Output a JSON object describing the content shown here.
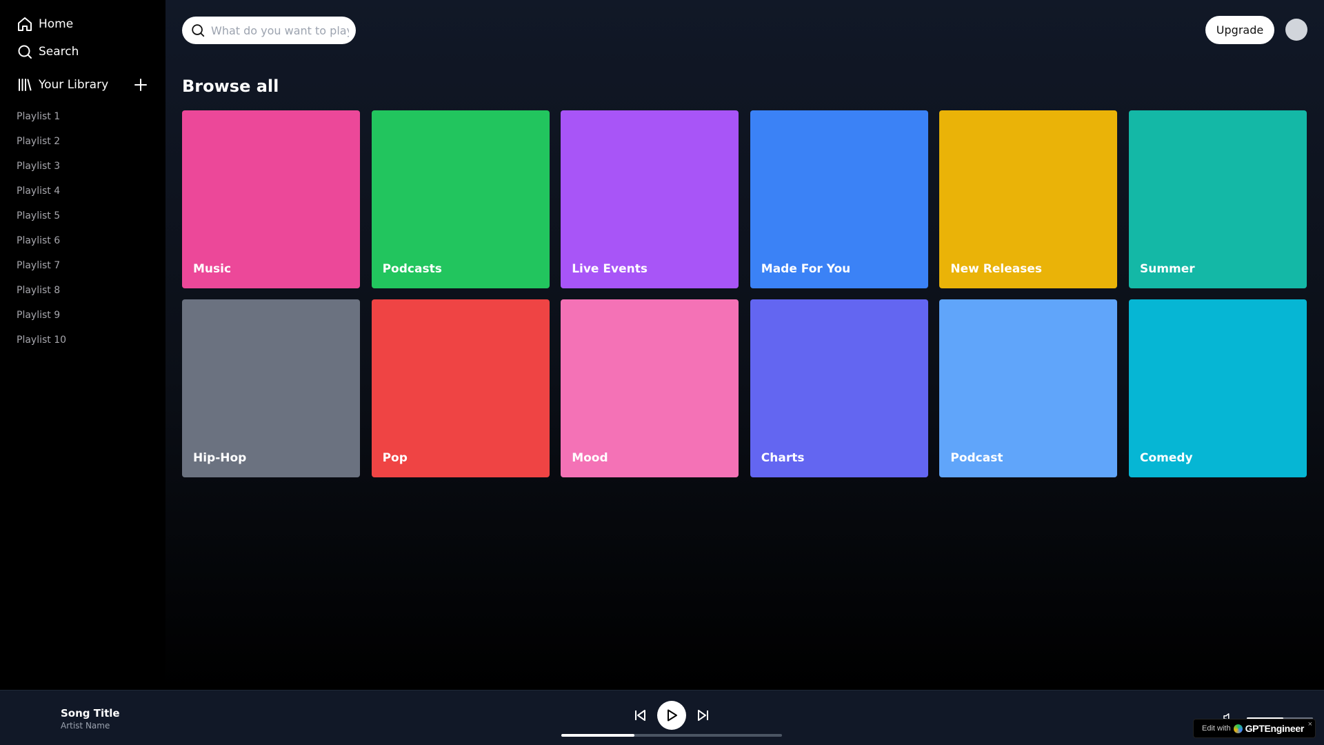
{
  "sidebar": {
    "nav": [
      {
        "label": "Home",
        "icon": "home-icon"
      },
      {
        "label": "Search",
        "icon": "search-icon"
      }
    ],
    "library_label": "Your Library",
    "playlists": [
      "Playlist 1",
      "Playlist 2",
      "Playlist 3",
      "Playlist 4",
      "Playlist 5",
      "Playlist 6",
      "Playlist 7",
      "Playlist 8",
      "Playlist 9",
      "Playlist 10"
    ]
  },
  "header": {
    "search_placeholder": "What do you want to play?",
    "upgrade_label": "Upgrade"
  },
  "browse": {
    "title": "Browse all",
    "categories": [
      {
        "label": "Music",
        "color": "#ec4899"
      },
      {
        "label": "Podcasts",
        "color": "#22c55e"
      },
      {
        "label": "Live Events",
        "color": "#a855f7"
      },
      {
        "label": "Made For You",
        "color": "#3b82f6"
      },
      {
        "label": "New Releases",
        "color": "#eab308"
      },
      {
        "label": "Summer",
        "color": "#14b8a6"
      },
      {
        "label": "Hip-Hop",
        "color": "#6b7280"
      },
      {
        "label": "Pop",
        "color": "#ef4444"
      },
      {
        "label": "Mood",
        "color": "#f472b6"
      },
      {
        "label": "Charts",
        "color": "#6366f1"
      },
      {
        "label": "Podcast",
        "color": "#60a5fa"
      },
      {
        "label": "Comedy",
        "color": "#06b6d4"
      }
    ]
  },
  "player": {
    "track_title": "Song Title",
    "artist_name": "Artist Name",
    "progress_percent": 33,
    "volume_percent": 55
  },
  "badge": {
    "prefix": "Edit with",
    "brand": "GPTEngineer",
    "close": "×"
  }
}
